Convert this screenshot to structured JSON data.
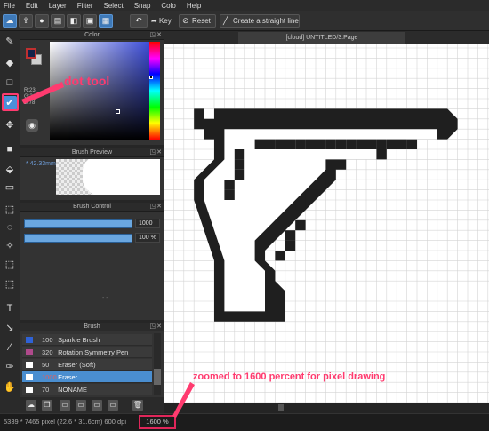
{
  "menu": [
    "File",
    "Edit",
    "Layer",
    "Filter",
    "Select",
    "Snap",
    "Colo",
    "Help"
  ],
  "toolbar": {
    "key_label": "Key",
    "reset_label": "Reset",
    "straight_line_label": "Create a straight line"
  },
  "tab": {
    "title": "[cloud] UNTITLED/3:Page"
  },
  "color_panel": {
    "title": "Color",
    "rgb": "R:23\nG:34\nB:78",
    "foreground": "#14224a",
    "background": "#d0d0d0"
  },
  "brush_preview": {
    "title": "Brush Preview",
    "size": "* 42.33mm"
  },
  "brush_control": {
    "title": "Brush Control",
    "size_value": "1000",
    "opacity_value": "100 %"
  },
  "brush": {
    "title": "Brush",
    "items": [
      {
        "size": "100",
        "name": "Sparkle Brush",
        "color": "#2f62d6"
      },
      {
        "size": "320",
        "name": "Rotation Symmetry Pen",
        "color": "#b04a8c"
      },
      {
        "size": "50",
        "name": "Eraser (Soft)",
        "color": "#ffffff"
      },
      {
        "size": "1000",
        "name": "Eraser",
        "color": "#ffffff",
        "selected": true
      },
      {
        "size": "70",
        "name": "NONAME",
        "color": "#ffffff"
      }
    ]
  },
  "status": {
    "dimensions": "5339 * 7465 pixel   (22.6 * 31.6cm)   600 dpi",
    "zoom": "1600 %"
  },
  "annotations": {
    "dot_tool": "dot tool",
    "zoom_note": "zoomed to 1600 percent for pixel drawing"
  },
  "accent_color": "#4a90d9",
  "annotation_color": "#ff3b6f"
}
